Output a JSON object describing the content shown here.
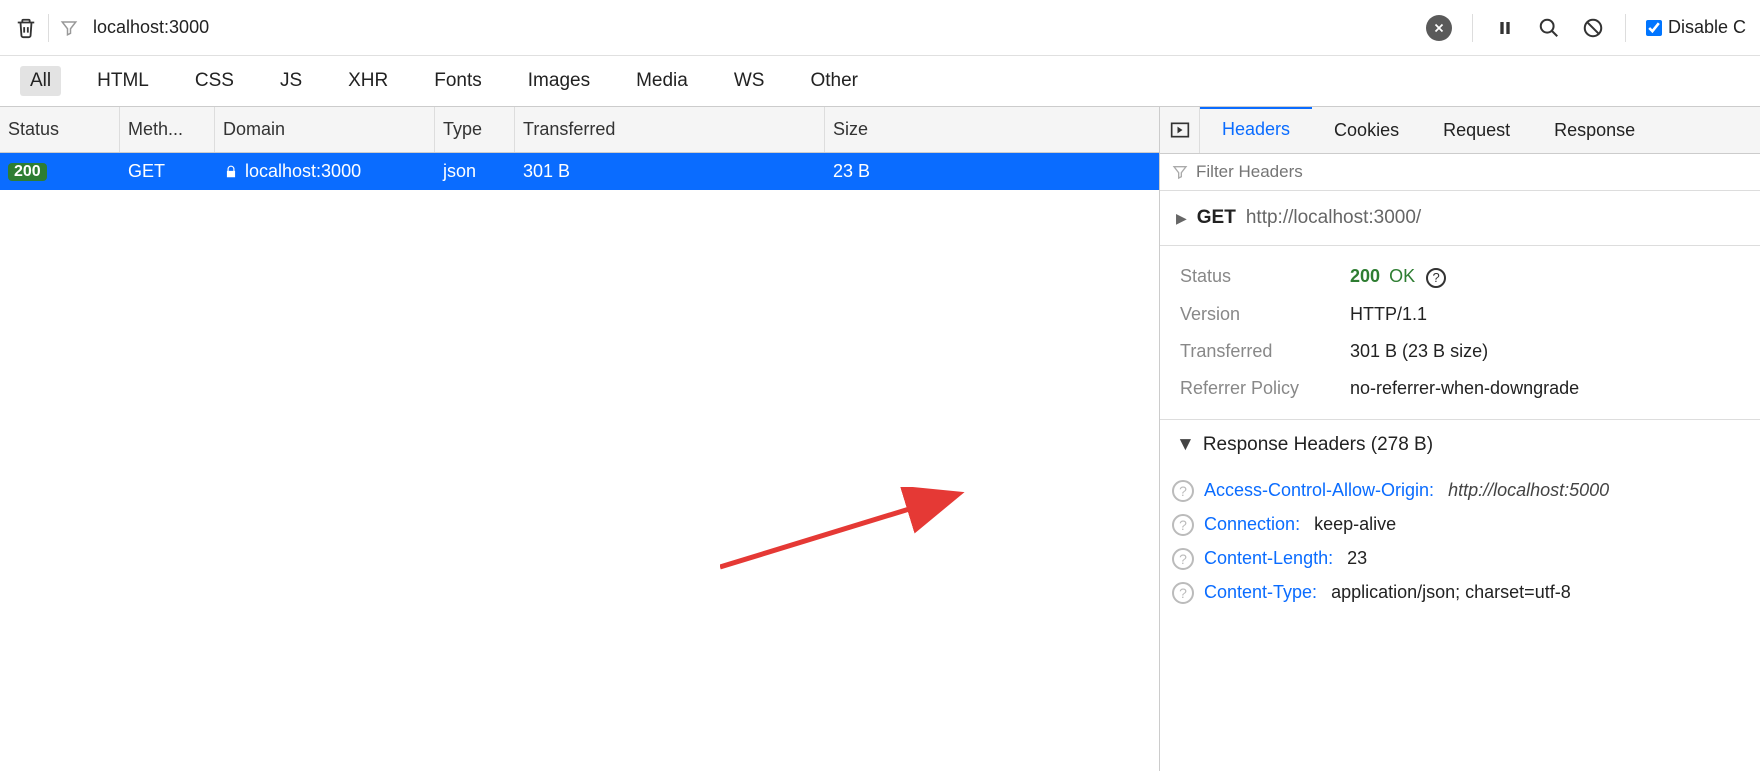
{
  "toolbar": {
    "url_filter_value": "localhost:3000",
    "disable_cache_label": "Disable C"
  },
  "filter_tabs": [
    "All",
    "HTML",
    "CSS",
    "JS",
    "XHR",
    "Fonts",
    "Images",
    "Media",
    "WS",
    "Other"
  ],
  "request_table": {
    "columns": [
      "Status",
      "Meth...",
      "Domain",
      "Type",
      "Transferred",
      "Size"
    ],
    "rows": [
      {
        "status": "200",
        "method": "GET",
        "domain": "localhost:3000",
        "type": "json",
        "transferred": "301 B",
        "size": "23 B"
      }
    ]
  },
  "detail_tabs": [
    "Headers",
    "Cookies",
    "Request",
    "Response"
  ],
  "filter_headers_placeholder": "Filter Headers",
  "summary": {
    "method": "GET",
    "url": "http://localhost:3000/"
  },
  "info": {
    "status_label": "Status",
    "status_code": "200",
    "status_text": "OK",
    "version_label": "Version",
    "version_value": "HTTP/1.1",
    "transferred_label": "Transferred",
    "transferred_value": "301 B (23 B size)",
    "referrer_label": "Referrer Policy",
    "referrer_value": "no-referrer-when-downgrade"
  },
  "response_headers_section_title": "Response Headers (278 B)",
  "response_headers": [
    {
      "name": "Access-Control-Allow-Origin:",
      "value": "http://localhost:5000",
      "italic": true
    },
    {
      "name": "Connection:",
      "value": "keep-alive",
      "italic": false
    },
    {
      "name": "Content-Length:",
      "value": "23",
      "italic": false
    },
    {
      "name": "Content-Type:",
      "value": "application/json; charset=utf-8",
      "italic": false
    }
  ]
}
